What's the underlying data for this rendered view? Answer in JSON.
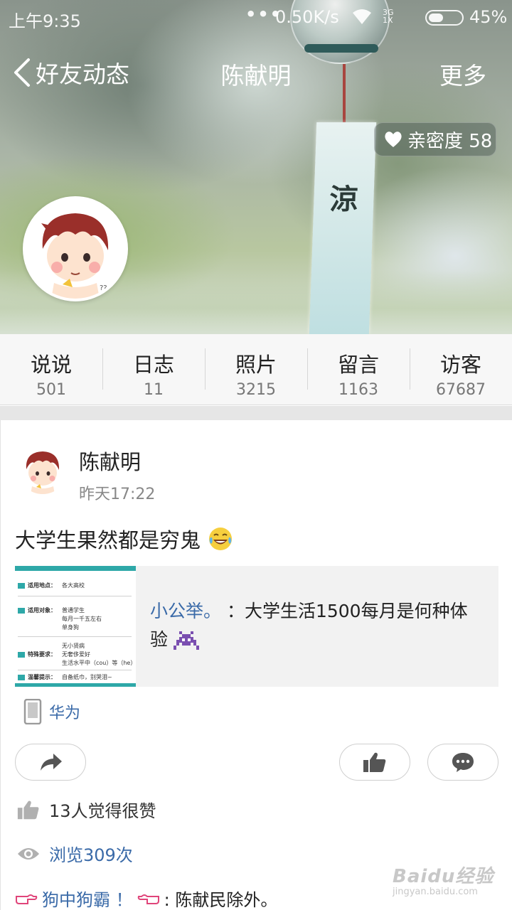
{
  "statusbar": {
    "time": "上午9:35",
    "dots": "•••",
    "speed": "0.50K/s",
    "network_top": "3G",
    "network_bottom": "1X",
    "battery_pct": "45%",
    "battery_level": 0.45
  },
  "navbar": {
    "back_label": "好友动态",
    "title": "陈献明",
    "more_label": "更多"
  },
  "hero": {
    "intimacy_label": "亲密度 58",
    "chime_glyph": "涼"
  },
  "stats": [
    {
      "label": "说说",
      "count": "501"
    },
    {
      "label": "日志",
      "count": "11"
    },
    {
      "label": "照片",
      "count": "3215"
    },
    {
      "label": "留言",
      "count": "1163"
    },
    {
      "label": "访客",
      "count": "67687"
    }
  ],
  "post": {
    "author": "陈献明",
    "time": "昨天17:22",
    "text": "大学生果然都是穷鬼",
    "share": {
      "source": "小公举。",
      "text": "：大学生活1500每月是何种体验",
      "thumb": {
        "rows": [
          {
            "key": "适用地点：",
            "value": "各大高校"
          },
          {
            "key": "适用对象：",
            "value": "普通学生"
          },
          {
            "key": "",
            "value": "每月一千五左右"
          },
          {
            "key": "",
            "value": "单身狗"
          },
          {
            "key": "",
            "value": "无小贤病"
          },
          {
            "key": "特殊要求：",
            "value": "无奢侈爱好"
          },
          {
            "key": "",
            "value": "生活水平中（cou）等（he）"
          },
          {
            "key": "温馨提示：",
            "value": "自备纸巾，别哭泪~"
          }
        ]
      }
    },
    "device": "华为",
    "likes_text": "13人觉得很赞",
    "views_text": "浏览309次",
    "comment": {
      "name": "狗中狗霸 ！",
      "text": ": 陈献民除外。"
    }
  },
  "watermark": {
    "main": "Baidu经验",
    "sub": "jingyan.baidu.com"
  },
  "colors": {
    "link": "#3a6aa8",
    "teal": "#2ea8a8"
  }
}
